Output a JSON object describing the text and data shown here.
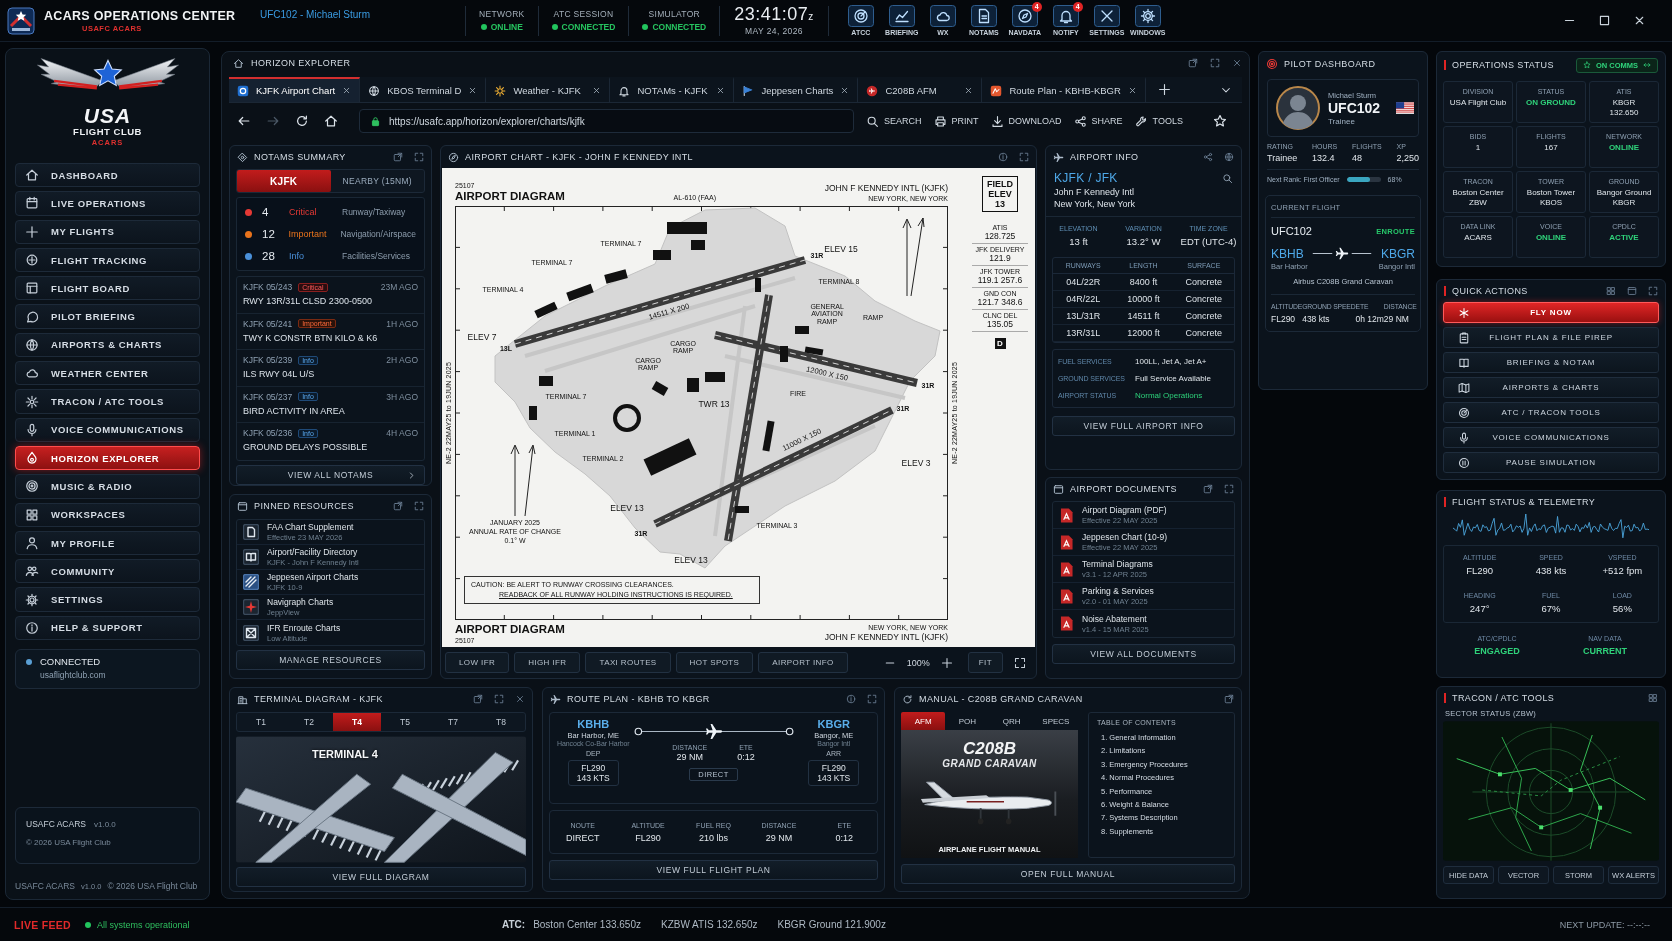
{
  "app": {
    "title": "ACARS OPERATIONS CENTER",
    "subtitle": "USAFC ACARS",
    "user": "UFC102 - Michael Sturm"
  },
  "connections": [
    {
      "label": "NETWORK",
      "value": "ONLINE",
      "ok": true
    },
    {
      "label": "ATC SESSION",
      "value": "CONNECTED",
      "ok": true
    },
    {
      "label": "SIMULATOR",
      "value": "CONNECTED",
      "ok": true
    }
  ],
  "clock": {
    "time": "23:41:07",
    "zone": "z",
    "date": "MAY 24, 2026"
  },
  "toolbar": [
    {
      "label": "ATCC"
    },
    {
      "label": "BRIEFING"
    },
    {
      "label": "WX"
    },
    {
      "label": "NOTAMS"
    },
    {
      "label": "NAVDATA",
      "badge": "4"
    },
    {
      "label": "NOTIFY",
      "badge": "4"
    },
    {
      "label": "SETTINGS"
    },
    {
      "label": "WINDOWS"
    }
  ],
  "sidebar": {
    "logo": {
      "name": "USA",
      "sub": "FLIGHT CLUB",
      "tag": "ACARS"
    },
    "items": [
      {
        "label": "DASHBOARD",
        "selected": false
      },
      {
        "label": "LIVE OPERATIONS",
        "selected": false
      },
      {
        "label": "MY FLIGHTS",
        "selected": false
      },
      {
        "label": "FLIGHT TRACKING",
        "selected": false
      },
      {
        "label": "FLIGHT BOARD",
        "selected": false
      },
      {
        "label": "PILOT BRIEFING",
        "selected": false
      },
      {
        "label": "AIRPORTS & CHARTS",
        "selected": false
      },
      {
        "label": "WEATHER CENTER",
        "selected": false
      },
      {
        "label": "TRACON / ATC TOOLS",
        "selected": false
      },
      {
        "label": "VOICE COMMUNICATIONS",
        "selected": false
      },
      {
        "label": "HORIZON EXPLORER",
        "selected": true
      },
      {
        "label": "MUSIC & RADIO",
        "selected": false
      },
      {
        "label": "WORKSPACES",
        "selected": false
      },
      {
        "label": "MY PROFILE",
        "selected": false
      },
      {
        "label": "COMMUNITY",
        "selected": false
      },
      {
        "label": "SETTINGS",
        "selected": false
      },
      {
        "label": "HELP & SUPPORT",
        "selected": false
      }
    ],
    "connection": {
      "status": "CONNECTED",
      "host": "usaflightclub.com"
    },
    "version": {
      "name": "USAFC ACARS",
      "version": "v1.0.0",
      "copyright": "© 2026 USA Flight Club"
    },
    "footer": {
      "name": "USAFC ACARS",
      "version": "v1.0.0",
      "copyright": "© 2026 USA Flight Club"
    }
  },
  "explorer": {
    "title": "HORIZON EXPLORER",
    "tabs": [
      {
        "label": "KJFK Airport Chart",
        "selected": true
      },
      {
        "label": "KBOS Terminal D",
        "selected": false
      },
      {
        "label": "Weather - KJFK",
        "selected": false
      },
      {
        "label": "NOTAMs - KJFK",
        "selected": false
      },
      {
        "label": "Jeppesen Charts",
        "selected": false
      },
      {
        "label": "C208B AFM",
        "selected": false
      },
      {
        "label": "Route Plan - KBHB-KBGR",
        "selected": false
      }
    ],
    "back_disabled": false,
    "forward_disabled": true,
    "url": "https://usafc.app/horizon/explorer/charts/kjfk",
    "actions": [
      {
        "label": "SEARCH"
      },
      {
        "label": "PRINT"
      },
      {
        "label": "DOWNLOAD"
      },
      {
        "label": "SHARE"
      },
      {
        "label": "TOOLS"
      }
    ]
  },
  "notams": {
    "title": "NOTAMS SUMMARY",
    "filters": [
      {
        "label": "KJFK",
        "selected": true
      },
      {
        "label": "NEARBY (15NM)",
        "selected": false
      }
    ],
    "summary": [
      {
        "count": "4",
        "level": "Critical",
        "category": "Runway/Taxiway",
        "color": "#e53935"
      },
      {
        "count": "12",
        "level": "Important",
        "category": "Navigation/Airspace",
        "color": "#e8731c"
      },
      {
        "count": "28",
        "level": "Info",
        "category": "Facilities/Services",
        "color": "#4a90d9"
      }
    ],
    "items": [
      {
        "id": "KJFK 05/243",
        "tag": "Critical",
        "kind": "critical",
        "age": "23M AGO",
        "text": "RWY 13R/31L CLSD 2300-0500"
      },
      {
        "id": "KJFK 05/241",
        "tag": "Important",
        "kind": "important",
        "age": "1H AGO",
        "text": "TWY K CONSTR BTN KILO & K6"
      },
      {
        "id": "KJFK 05/239",
        "tag": "Info",
        "kind": "info",
        "age": "2H AGO",
        "text": "ILS RWY 04L U/S"
      },
      {
        "id": "KJFK 05/237",
        "tag": "Info",
        "kind": "info",
        "age": "3H AGO",
        "text": "BIRD ACTIVITY IN AREA"
      },
      {
        "id": "KJFK 05/236",
        "tag": "Info",
        "kind": "info",
        "age": "4H AGO",
        "text": "GROUND DELAYS POSSIBLE"
      }
    ],
    "button": "VIEW ALL NOTAMS"
  },
  "pinned": {
    "title": "PINNED RESOURCES",
    "items": [
      {
        "name": "FAA Chart Supplement",
        "detail": "Effective 23 MAY 2026"
      },
      {
        "name": "Airport/Facility Directory",
        "detail": "KJFK - John F Kennedy Intl"
      },
      {
        "name": "Jeppesen Airport Charts",
        "detail": "KJFK 10-9"
      },
      {
        "name": "Navigraph Charts",
        "detail": "JeppView"
      },
      {
        "name": "IFR Enroute Charts",
        "detail": "Low Altitude"
      }
    ],
    "button": "MANAGE RESOURCES"
  },
  "chart": {
    "title": "AIRPORT CHART - KJFK - JOHN F KENNEDY INTL",
    "sheet": {
      "number": "25107",
      "heading": "AIRPORT DIAGRAM",
      "reference": "AL-610 (FAA)",
      "airport": "JOHN F KENNEDY INTL (KJFK)",
      "city": "NEW YORK, NEW YORK",
      "field_elevation": "FIELD ELEV 13",
      "frequencies": [
        {
          "name": "ATIS",
          "value": "128.725"
        },
        {
          "name": "JFK DELIVERY",
          "value": "121.9"
        },
        {
          "name": "JFK TOWER",
          "value": "119.1 257.6"
        },
        {
          "name": "GND CON",
          "value": "121.7 348.6"
        },
        {
          "name": "CLNC DEL",
          "value": "135.05"
        }
      ],
      "symbol": "D",
      "side_notes": [
        "NE-2 22MAY25 to 19JUN 2025",
        "NE-2 22MAY25 to 19JUN 2025"
      ],
      "labels": [
        {
          "text": "TERMINAL 7",
          "kind": "area"
        },
        {
          "text": "ELEV 15",
          "kind": "elev"
        },
        {
          "text": "31R",
          "kind": "runway"
        },
        {
          "text": "TERMINAL 7",
          "kind": "area"
        },
        {
          "text": "TERMINAL 8",
          "kind": "area"
        },
        {
          "text": "TERMINAL 4",
          "kind": "area"
        },
        {
          "text": "14511 X 200",
          "kind": "dimension"
        },
        {
          "text": "GENERAL AVIATION RAMP",
          "kind": "ramp"
        },
        {
          "text": "RAMP",
          "kind": "area"
        },
        {
          "text": "ELEV 7",
          "kind": "elev"
        },
        {
          "text": "13L",
          "kind": "runway"
        },
        {
          "text": "CARGO RAMP",
          "kind": "ramp"
        },
        {
          "text": "CARGO RAMP",
          "kind": "ramp"
        },
        {
          "text": "12000 X 150",
          "kind": "dimension"
        },
        {
          "text": "31R",
          "kind": "runway"
        },
        {
          "text": "FIRE",
          "kind": "area"
        },
        {
          "text": "TERMINAL 7",
          "kind": "area"
        },
        {
          "text": "TWR 13",
          "kind": "elev"
        },
        {
          "text": "31R",
          "kind": "runway"
        },
        {
          "text": "TERMINAL 1",
          "kind": "area"
        },
        {
          "text": "11000 X 150",
          "kind": "dimension"
        },
        {
          "text": "TERMINAL 2",
          "kind": "area"
        },
        {
          "text": "ELEV 3",
          "kind": "elev"
        },
        {
          "text": "ELEV 13",
          "kind": "elev"
        },
        {
          "text": "TERMINAL 3",
          "kind": "area"
        },
        {
          "text": "31R",
          "kind": "runway"
        },
        {
          "text": "ELEV 13",
          "kind": "elev"
        }
      ],
      "variation": [
        "JANUARY 2025",
        "ANNUAL RATE OF CHANGE",
        "0.1° W"
      ],
      "caution": [
        "CAUTION: BE ALERT TO RUNWAY CROSSING CLEARANCES.",
        "READBACK OF ALL RUNWAY HOLDING INSTRUCTIONS IS REQUIRED."
      ],
      "footer_heading": "AIRPORT DIAGRAM",
      "footer_number": "25107",
      "footer_city": "NEW YORK, NEW YORK",
      "footer_airport": "JOHN F KENNEDY INTL (KJFK)"
    },
    "layers": [
      {
        "label": "LOW IFR"
      },
      {
        "label": "HIGH IFR"
      },
      {
        "label": "TAXI ROUTES"
      },
      {
        "label": "HOT SPOTS"
      },
      {
        "label": "AIRPORT INFO"
      }
    ],
    "zoom": "100%",
    "fit": "FIT"
  },
  "airport_info": {
    "title": "AIRPORT INFO",
    "ident": "KJFK / JFK",
    "name": "John F Kennedy Intl",
    "city": "New York, New York",
    "stats": [
      {
        "label": "ELEVATION",
        "value": "13 ft"
      },
      {
        "label": "VARIATION",
        "value": "13.2° W"
      },
      {
        "label": "TIME ZONE",
        "value": "EDT (UTC-4)"
      }
    ],
    "runways": {
      "columns": [
        "RUNWAYS",
        "LENGTH",
        "SURFACE"
      ],
      "rows": [
        [
          "04L/22R",
          "8400 ft",
          "Concrete"
        ],
        [
          "04R/22L",
          "10000 ft",
          "Concrete"
        ],
        [
          "13L/31R",
          "14511 ft",
          "Concrete"
        ],
        [
          "13R/31L",
          "12000 ft",
          "Concrete"
        ]
      ]
    },
    "services": [
      {
        "label": "FUEL SERVICES",
        "value": "100LL, Jet A, Jet A+",
        "kind": "plain"
      },
      {
        "label": "GROUND SERVICES",
        "value": "Full Service Available",
        "kind": "plain"
      },
      {
        "label": "AIRPORT STATUS",
        "value": "Normal Operations",
        "kind": "status"
      }
    ],
    "button": "VIEW FULL AIRPORT INFO"
  },
  "documents": {
    "title": "AIRPORT DOCUMENTS",
    "items": [
      {
        "name": "Airport Diagram (PDF)",
        "detail": "Effective 22 MAY 2025"
      },
      {
        "name": "Jeppesen Chart (10-9)",
        "detail": "Effective 22 MAY 2025"
      },
      {
        "name": "Terminal Diagrams",
        "detail": "v3.1 - 12 APR 2025"
      },
      {
        "name": "Parking & Services",
        "detail": "v2.0 - 01 MAY 2025"
      },
      {
        "name": "Noise Abatement",
        "detail": "v1.4 - 15 MAR 2025"
      }
    ],
    "button": "VIEW ALL DOCUMENTS"
  },
  "terminal": {
    "title": "TERMINAL DIAGRAM - KJFK",
    "tabs": [
      {
        "label": "T1",
        "selected": false
      },
      {
        "label": "T2",
        "selected": false
      },
      {
        "label": "T4",
        "selected": true
      },
      {
        "label": "T5",
        "selected": false
      },
      {
        "label": "T7",
        "selected": false
      },
      {
        "label": "T8",
        "selected": false
      }
    ],
    "caption": "TERMINAL 4",
    "button": "VIEW FULL DIAGRAM"
  },
  "route": {
    "title": "ROUTE PLAN - KBHB TO KBGR",
    "departure": {
      "code": "KBHB",
      "city": "Bar Harbor, ME",
      "name": "Hancock Co-Bar Harbor",
      "role": "DEP",
      "altitude": "FL290",
      "speed": "143 KTS"
    },
    "arrival": {
      "code": "KBGR",
      "city": "Bangor, ME",
      "name": "Bangor Intl",
      "role": "ARR",
      "altitude": "FL290",
      "speed": "143 KTS"
    },
    "legs": [
      {
        "label": "DISTANCE",
        "value": "29 NM"
      },
      {
        "label": "ETE",
        "value": "0:12"
      }
    ],
    "route_tag": "DIRECT",
    "summary": [
      {
        "label": "NOUTE",
        "value": "DIRECT"
      },
      {
        "label": "ALTITUDE",
        "value": "FL290"
      },
      {
        "label": "FUEL REQ",
        "value": "210 lbs"
      },
      {
        "label": "DISTANCE",
        "value": "29 NM"
      },
      {
        "label": "ETE",
        "value": "0:12"
      }
    ],
    "button": "VIEW FULL FLIGHT PLAN"
  },
  "manual": {
    "title": "MANUAL - C208B GRAND CARAVAN",
    "tabs": [
      {
        "label": "AFM",
        "selected": true
      },
      {
        "label": "POH",
        "selected": false
      },
      {
        "label": "QRH",
        "selected": false
      },
      {
        "label": "SPECS",
        "selected": false
      }
    ],
    "cover": {
      "model": "C208B",
      "name": "GRAND CARAVAN",
      "caption": "AIRPLANE FLIGHT MANUAL"
    },
    "toc_title": "TABLE OF CONTENTS",
    "toc": [
      "1. General Information",
      "2. Limitations",
      "3. Emergency Procedures",
      "4. Normal Procedures",
      "5. Performance",
      "6. Weight & Balance",
      "7. Systems Description",
      "8. Supplements"
    ],
    "button": "OPEN FULL MANUAL"
  },
  "pilot": {
    "title": "PILOT DASHBOARD",
    "name": "Michael Sturm",
    "callsign": "UFC102",
    "rank": "Trainee",
    "stats": [
      {
        "label": "RATING",
        "value": "Trainee"
      },
      {
        "label": "HOURS",
        "value": "132.4"
      },
      {
        "label": "FLIGHTS",
        "value": "48"
      },
      {
        "label": "XP",
        "value": "2,250"
      }
    ],
    "progress": {
      "label": "Next Rank: First Officer",
      "level": 0.68,
      "reading": "68%"
    },
    "flight": {
      "title": "CURRENT FLIGHT",
      "callsign": "UFC102",
      "status": "ENROUTE",
      "from": {
        "code": "KBHB",
        "name": "Bar Harbor"
      },
      "to": {
        "code": "KBGR",
        "name": "Bangor Intl"
      },
      "aircraft": "Airbus C208B Grand Caravan",
      "stats": [
        {
          "label": "ALTITUDE",
          "value": "FL290"
        },
        {
          "label": "GROUND SPEED",
          "value": "438 kts"
        },
        {
          "label": "ETE",
          "value": "0h 12m"
        },
        {
          "label": "DISTANCE",
          "value": "29 NM"
        }
      ]
    }
  },
  "operations": {
    "title": "OPERATIONS STATUS",
    "comms": "ON COMMS",
    "cells": [
      {
        "label": "DIVISION",
        "values": [
          "USA Flight Club"
        ],
        "kind": "plain"
      },
      {
        "label": "STATUS",
        "values": [
          "ON GROUND"
        ],
        "kind": "good"
      },
      {
        "label": "ATIS",
        "values": [
          "KBGR",
          "132.650"
        ],
        "kind": "plain"
      },
      {
        "label": "BIDS",
        "values": [
          "1"
        ],
        "kind": "plain"
      },
      {
        "label": "FLIGHTS",
        "values": [
          "167"
        ],
        "kind": "plain"
      },
      {
        "label": "NETWORK",
        "values": [
          "ONLINE"
        ],
        "kind": "good"
      },
      {
        "label": "TRACON",
        "values": [
          "Boston Center",
          "ZBW"
        ],
        "kind": "plain"
      },
      {
        "label": "TOWER",
        "values": [
          "Boston Tower",
          "KBOS"
        ],
        "kind": "plain"
      },
      {
        "label": "GROUND",
        "values": [
          "Bangor Ground",
          "KBGR"
        ],
        "kind": "plain"
      },
      {
        "label": "DATA LINK",
        "values": [
          "ACARS"
        ],
        "kind": "plain"
      },
      {
        "label": "VOICE",
        "values": [
          "ONLINE"
        ],
        "kind": "good"
      },
      {
        "label": "CPDLC",
        "values": [
          "ACTIVE"
        ],
        "kind": "good"
      }
    ]
  },
  "quick_actions": {
    "title": "QUICK ACTIONS",
    "items": [
      {
        "label": "FLY NOW",
        "kind": "primary"
      },
      {
        "label": "FLIGHT PLAN & FILE PIREP",
        "kind": "normal"
      },
      {
        "label": "BRIEFING & NOTAM",
        "kind": "normal"
      },
      {
        "label": "AIRPORTS & CHARTS",
        "kind": "normal"
      },
      {
        "label": "ATC / TRACON TOOLS",
        "kind": "normal"
      },
      {
        "label": "VOICE COMMUNICATIONS",
        "kind": "normal"
      },
      {
        "label": "PAUSE SIMULATION",
        "kind": "normal"
      }
    ]
  },
  "telemetry": {
    "title": "FLIGHT STATUS & TELEMETRY",
    "readings": [
      {
        "label": "ALTITUDE",
        "value": "FL290"
      },
      {
        "label": "SPEED",
        "value": "438 kts"
      },
      {
        "label": "VSPEED",
        "value": "+512 fpm"
      },
      {
        "label": "HEADING",
        "value": "247°"
      },
      {
        "label": "FUEL",
        "value": "67%"
      },
      {
        "label": "LOAD",
        "value": "56%"
      }
    ],
    "status": [
      {
        "label": "ATC/CPDLC",
        "value": "ENGAGED"
      },
      {
        "label": "NAV DATA",
        "value": "CURRENT"
      }
    ]
  },
  "tracon": {
    "title": "TRACON / ATC TOOLS",
    "subtitle": "SECTOR STATUS (ZBW)",
    "buttons": [
      {
        "label": "HIDE DATA"
      },
      {
        "label": "VECTOR"
      },
      {
        "label": "STORM"
      },
      {
        "label": "WX ALERTS"
      }
    ]
  },
  "status_bar": {
    "feed": "LIVE FEED",
    "health": "All systems operational",
    "atc_label": "ATC:",
    "frequencies": [
      "Boston Center 133.650z",
      "KZBW ATIS 132.650z",
      "KBGR Ground 121.900z"
    ],
    "next_update": "NEXT UPDATE: --:--:--"
  }
}
